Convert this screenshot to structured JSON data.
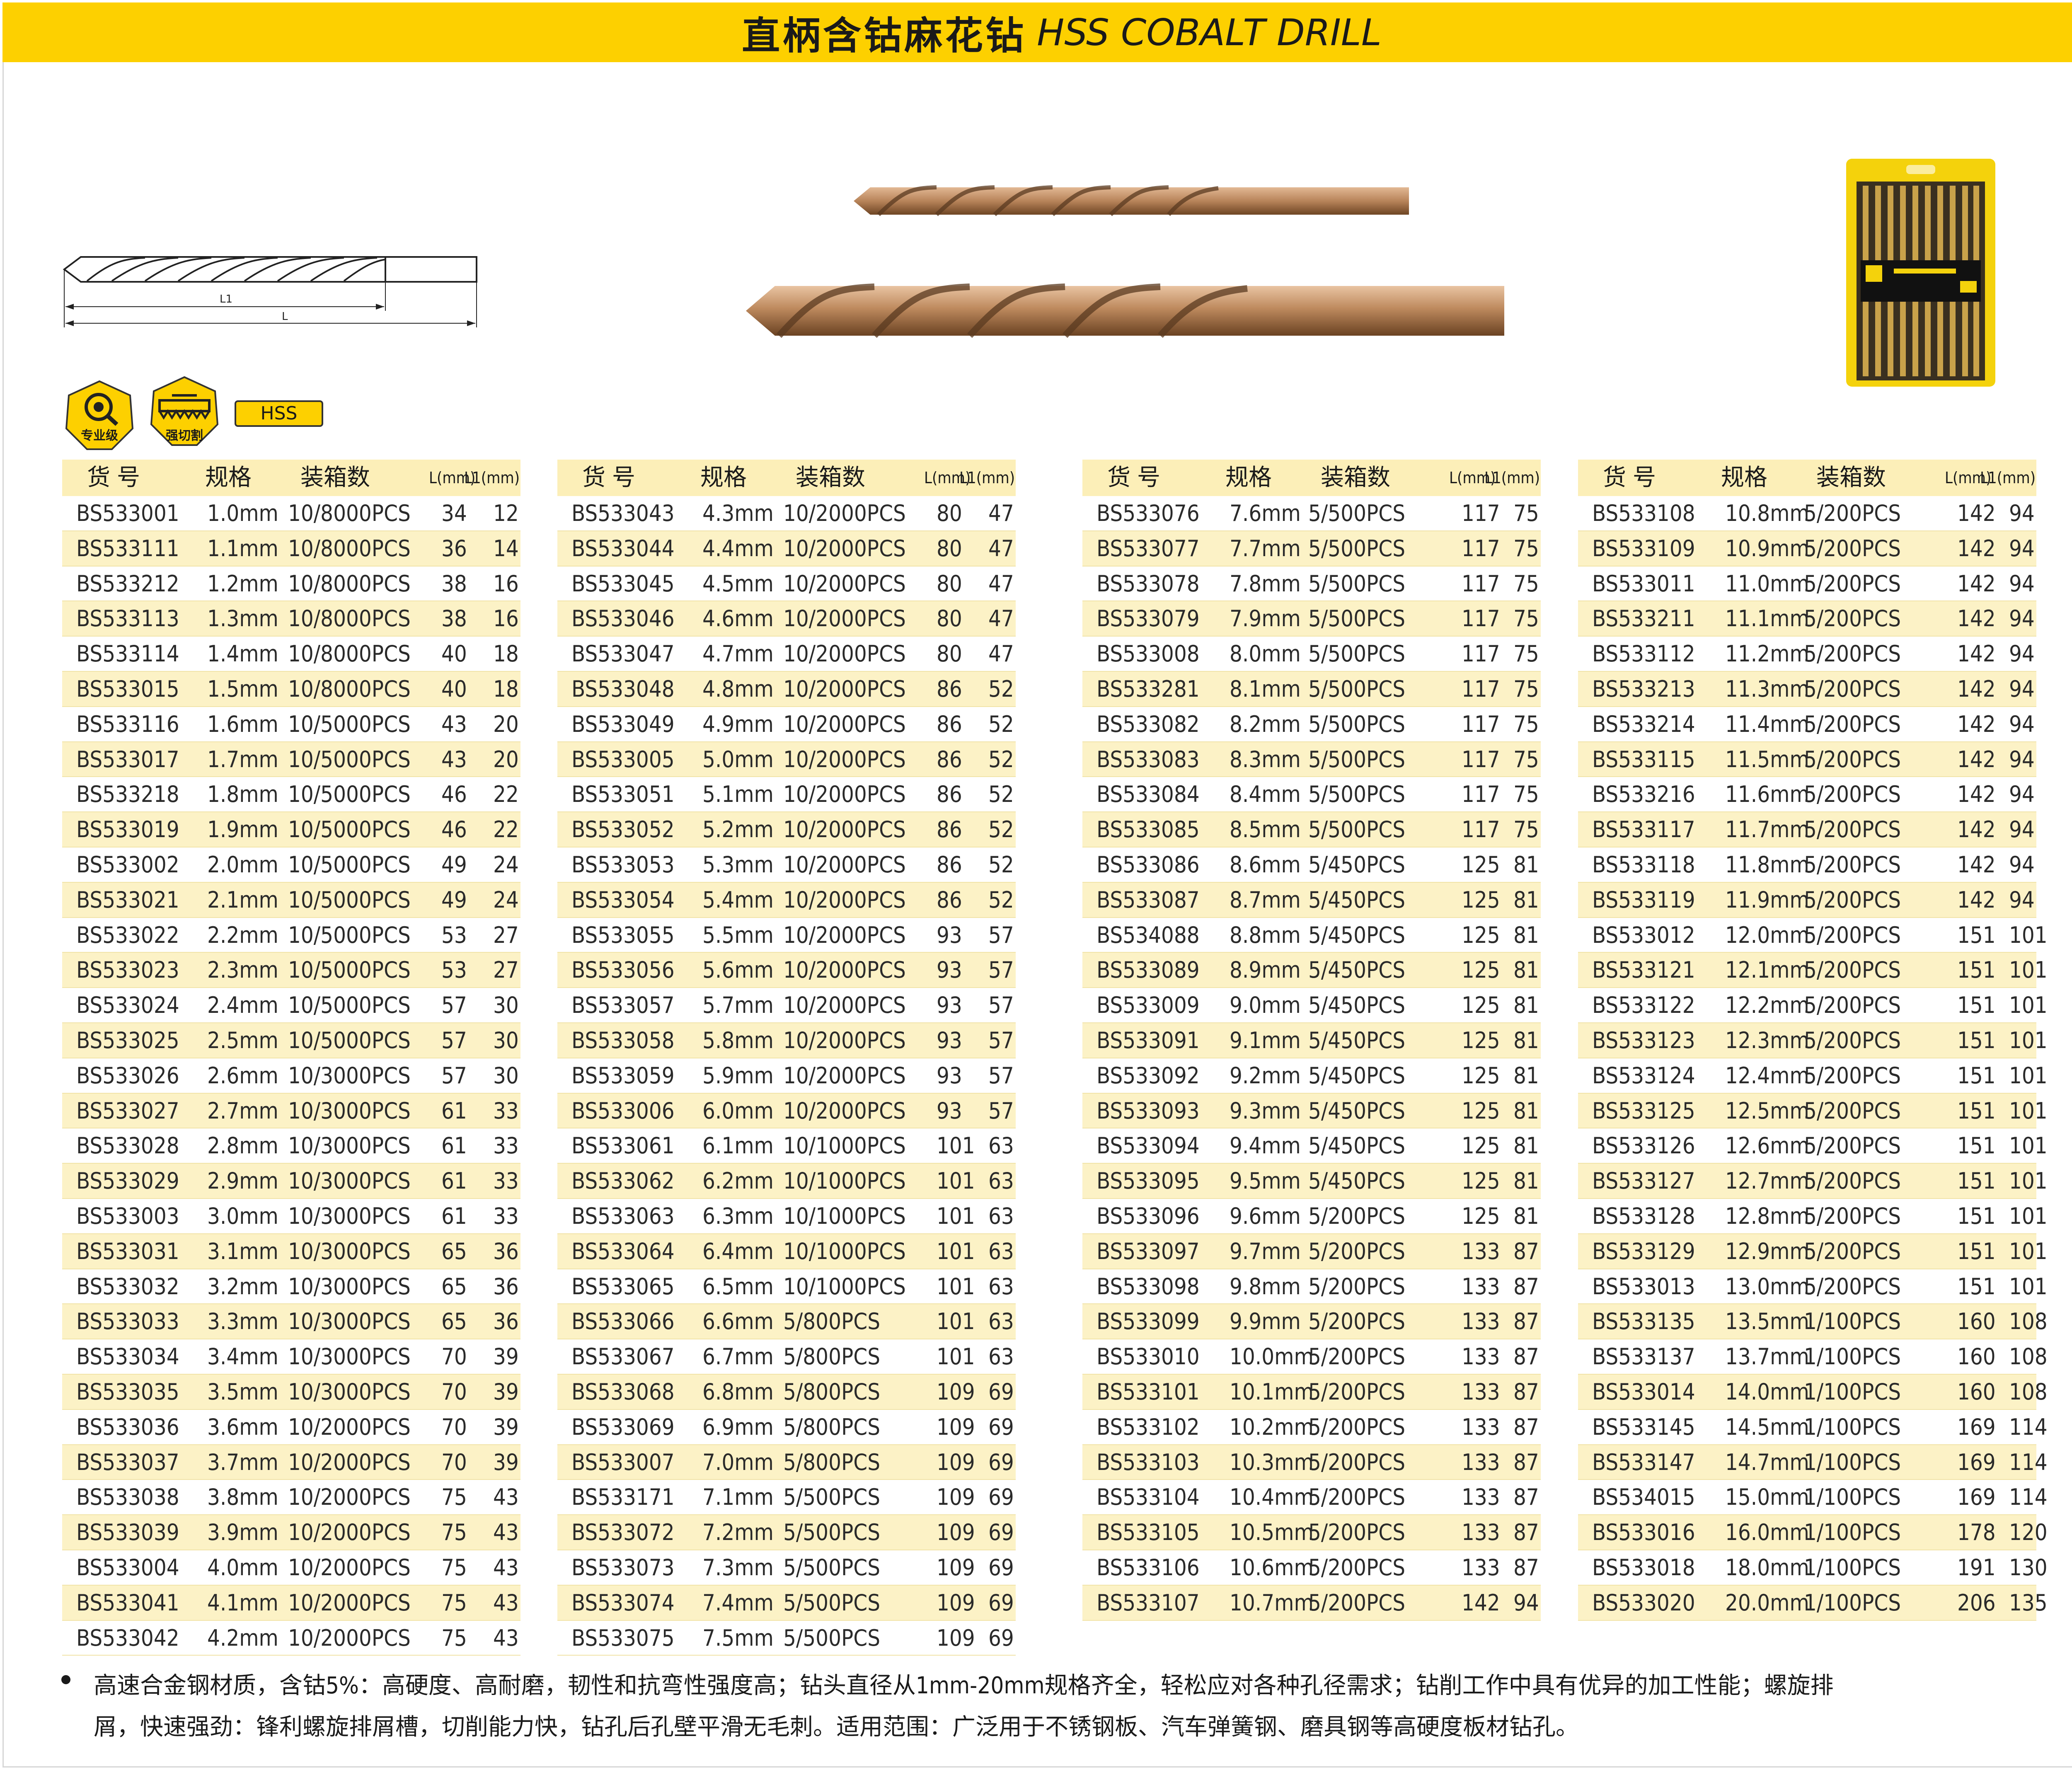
{
  "header": {
    "title_cn": "直柄含钴麻花钻",
    "title_en": "HSS COBALT DRILL"
  },
  "diagram": {
    "label_l1": "L1",
    "label_l": "L"
  },
  "badges": [
    {
      "label": "专业级",
      "icon": "magnifier-gear-icon"
    },
    {
      "label": "强切割",
      "icon": "saw-blade-icon"
    }
  ],
  "material_tag": "HSS",
  "table_headers": {
    "code": "货 号",
    "spec": "规格",
    "pack": "装箱数",
    "l": "L(mm)",
    "l1": "L1(mm)"
  },
  "tables": [
    [
      [
        "BS533001",
        "1.0mm",
        "10/8000PCS",
        "34",
        "12"
      ],
      [
        "BS533111",
        "1.1mm",
        "10/8000PCS",
        "36",
        "14"
      ],
      [
        "BS533212",
        "1.2mm",
        "10/8000PCS",
        "38",
        "16"
      ],
      [
        "BS533113",
        "1.3mm",
        "10/8000PCS",
        "38",
        "16"
      ],
      [
        "BS533114",
        "1.4mm",
        "10/8000PCS",
        "40",
        "18"
      ],
      [
        "BS533015",
        "1.5mm",
        "10/8000PCS",
        "40",
        "18"
      ],
      [
        "BS533116",
        "1.6mm",
        "10/5000PCS",
        "43",
        "20"
      ],
      [
        "BS533017",
        "1.7mm",
        "10/5000PCS",
        "43",
        "20"
      ],
      [
        "BS533218",
        "1.8mm",
        "10/5000PCS",
        "46",
        "22"
      ],
      [
        "BS533019",
        "1.9mm",
        "10/5000PCS",
        "46",
        "22"
      ],
      [
        "BS533002",
        "2.0mm",
        "10/5000PCS",
        "49",
        "24"
      ],
      [
        "BS533021",
        "2.1mm",
        "10/5000PCS",
        "49",
        "24"
      ],
      [
        "BS533022",
        "2.2mm",
        "10/5000PCS",
        "53",
        "27"
      ],
      [
        "BS533023",
        "2.3mm",
        "10/5000PCS",
        "53",
        "27"
      ],
      [
        "BS533024",
        "2.4mm",
        "10/5000PCS",
        "57",
        "30"
      ],
      [
        "BS533025",
        "2.5mm",
        "10/5000PCS",
        "57",
        "30"
      ],
      [
        "BS533026",
        "2.6mm",
        "10/3000PCS",
        "57",
        "30"
      ],
      [
        "BS533027",
        "2.7mm",
        "10/3000PCS",
        "61",
        "33"
      ],
      [
        "BS533028",
        "2.8mm",
        "10/3000PCS",
        "61",
        "33"
      ],
      [
        "BS533029",
        "2.9mm",
        "10/3000PCS",
        "61",
        "33"
      ],
      [
        "BS533003",
        "3.0mm",
        "10/3000PCS",
        "61",
        "33"
      ],
      [
        "BS533031",
        "3.1mm",
        "10/3000PCS",
        "65",
        "36"
      ],
      [
        "BS533032",
        "3.2mm",
        "10/3000PCS",
        "65",
        "36"
      ],
      [
        "BS533033",
        "3.3mm",
        "10/3000PCS",
        "65",
        "36"
      ],
      [
        "BS533034",
        "3.4mm",
        "10/3000PCS",
        "70",
        "39"
      ],
      [
        "BS533035",
        "3.5mm",
        "10/3000PCS",
        "70",
        "39"
      ],
      [
        "BS533036",
        "3.6mm",
        "10/2000PCS",
        "70",
        "39"
      ],
      [
        "BS533037",
        "3.7mm",
        "10/2000PCS",
        "70",
        "39"
      ],
      [
        "BS533038",
        "3.8mm",
        "10/2000PCS",
        "75",
        "43"
      ],
      [
        "BS533039",
        "3.9mm",
        "10/2000PCS",
        "75",
        "43"
      ],
      [
        "BS533004",
        "4.0mm",
        "10/2000PCS",
        "75",
        "43"
      ],
      [
        "BS533041",
        "4.1mm",
        "10/2000PCS",
        "75",
        "43"
      ],
      [
        "BS533042",
        "4.2mm",
        "10/2000PCS",
        "75",
        "43"
      ]
    ],
    [
      [
        "BS533043",
        "4.3mm",
        "10/2000PCS",
        "80",
        "47"
      ],
      [
        "BS533044",
        "4.4mm",
        "10/2000PCS",
        "80",
        "47"
      ],
      [
        "BS533045",
        "4.5mm",
        "10/2000PCS",
        "80",
        "47"
      ],
      [
        "BS533046",
        "4.6mm",
        "10/2000PCS",
        "80",
        "47"
      ],
      [
        "BS533047",
        "4.7mm",
        "10/2000PCS",
        "80",
        "47"
      ],
      [
        "BS533048",
        "4.8mm",
        "10/2000PCS",
        "86",
        "52"
      ],
      [
        "BS533049",
        "4.9mm",
        "10/2000PCS",
        "86",
        "52"
      ],
      [
        "BS533005",
        "5.0mm",
        "10/2000PCS",
        "86",
        "52"
      ],
      [
        "BS533051",
        "5.1mm",
        "10/2000PCS",
        "86",
        "52"
      ],
      [
        "BS533052",
        "5.2mm",
        "10/2000PCS",
        "86",
        "52"
      ],
      [
        "BS533053",
        "5.3mm",
        "10/2000PCS",
        "86",
        "52"
      ],
      [
        "BS533054",
        "5.4mm",
        "10/2000PCS",
        "86",
        "52"
      ],
      [
        "BS533055",
        "5.5mm",
        "10/2000PCS",
        "93",
        "57"
      ],
      [
        "BS533056",
        "5.6mm",
        "10/2000PCS",
        "93",
        "57"
      ],
      [
        "BS533057",
        "5.7mm",
        "10/2000PCS",
        "93",
        "57"
      ],
      [
        "BS533058",
        "5.8mm",
        "10/2000PCS",
        "93",
        "57"
      ],
      [
        "BS533059",
        "5.9mm",
        "10/2000PCS",
        "93",
        "57"
      ],
      [
        "BS533006",
        "6.0mm",
        "10/2000PCS",
        "93",
        "57"
      ],
      [
        "BS533061",
        "6.1mm",
        "10/1000PCS",
        "101",
        "63"
      ],
      [
        "BS533062",
        "6.2mm",
        "10/1000PCS",
        "101",
        "63"
      ],
      [
        "BS533063",
        "6.3mm",
        "10/1000PCS",
        "101",
        "63"
      ],
      [
        "BS533064",
        "6.4mm",
        "10/1000PCS",
        "101",
        "63"
      ],
      [
        "BS533065",
        "6.5mm",
        "10/1000PCS",
        "101",
        "63"
      ],
      [
        "BS533066",
        "6.6mm",
        "5/800PCS",
        "101",
        "63"
      ],
      [
        "BS533067",
        "6.7mm",
        "5/800PCS",
        "101",
        "63"
      ],
      [
        "BS533068",
        "6.8mm",
        "5/800PCS",
        "109",
        "69"
      ],
      [
        "BS533069",
        "6.9mm",
        "5/800PCS",
        "109",
        "69"
      ],
      [
        "BS533007",
        "7.0mm",
        "5/800PCS",
        "109",
        "69"
      ],
      [
        "BS533171",
        "7.1mm",
        "5/500PCS",
        "109",
        "69"
      ],
      [
        "BS533072",
        "7.2mm",
        "5/500PCS",
        "109",
        "69"
      ],
      [
        "BS533073",
        "7.3mm",
        "5/500PCS",
        "109",
        "69"
      ],
      [
        "BS533074",
        "7.4mm",
        "5/500PCS",
        "109",
        "69"
      ],
      [
        "BS533075",
        "7.5mm",
        "5/500PCS",
        "109",
        "69"
      ]
    ],
    [
      [
        "BS533076",
        "7.6mm",
        "5/500PCS",
        "117",
        "75"
      ],
      [
        "BS533077",
        "7.7mm",
        "5/500PCS",
        "117",
        "75"
      ],
      [
        "BS533078",
        "7.8mm",
        "5/500PCS",
        "117",
        "75"
      ],
      [
        "BS533079",
        "7.9mm",
        "5/500PCS",
        "117",
        "75"
      ],
      [
        "BS533008",
        "8.0mm",
        "5/500PCS",
        "117",
        "75"
      ],
      [
        "BS533281",
        "8.1mm",
        "5/500PCS",
        "117",
        "75"
      ],
      [
        "BS533082",
        "8.2mm",
        "5/500PCS",
        "117",
        "75"
      ],
      [
        "BS533083",
        "8.3mm",
        "5/500PCS",
        "117",
        "75"
      ],
      [
        "BS533084",
        "8.4mm",
        "5/500PCS",
        "117",
        "75"
      ],
      [
        "BS533085",
        "8.5mm",
        "5/500PCS",
        "117",
        "75"
      ],
      [
        "BS533086",
        "8.6mm",
        "5/450PCS",
        "125",
        "81"
      ],
      [
        "BS533087",
        "8.7mm",
        "5/450PCS",
        "125",
        "81"
      ],
      [
        "BS534088",
        "8.8mm",
        "5/450PCS",
        "125",
        "81"
      ],
      [
        "BS533089",
        "8.9mm",
        "5/450PCS",
        "125",
        "81"
      ],
      [
        "BS533009",
        "9.0mm",
        "5/450PCS",
        "125",
        "81"
      ],
      [
        "BS533091",
        "9.1mm",
        "5/450PCS",
        "125",
        "81"
      ],
      [
        "BS533092",
        "9.2mm",
        "5/450PCS",
        "125",
        "81"
      ],
      [
        "BS533093",
        "9.3mm",
        "5/450PCS",
        "125",
        "81"
      ],
      [
        "BS533094",
        "9.4mm",
        "5/450PCS",
        "125",
        "81"
      ],
      [
        "BS533095",
        "9.5mm",
        "5/450PCS",
        "125",
        "81"
      ],
      [
        "BS533096",
        "9.6mm",
        "5/200PCS",
        "125",
        "81"
      ],
      [
        "BS533097",
        "9.7mm",
        "5/200PCS",
        "133",
        "87"
      ],
      [
        "BS533098",
        "9.8mm",
        "5/200PCS",
        "133",
        "87"
      ],
      [
        "BS533099",
        "9.9mm",
        "5/200PCS",
        "133",
        "87"
      ],
      [
        "BS533010",
        "10.0mm",
        "5/200PCS",
        "133",
        "87"
      ],
      [
        "BS533101",
        "10.1mm",
        "5/200PCS",
        "133",
        "87"
      ],
      [
        "BS533102",
        "10.2mm",
        "5/200PCS",
        "133",
        "87"
      ],
      [
        "BS533103",
        "10.3mm",
        "5/200PCS",
        "133",
        "87"
      ],
      [
        "BS533104",
        "10.4mm",
        "5/200PCS",
        "133",
        "87"
      ],
      [
        "BS533105",
        "10.5mm",
        "5/200PCS",
        "133",
        "87"
      ],
      [
        "BS533106",
        "10.6mm",
        "5/200PCS",
        "133",
        "87"
      ],
      [
        "BS533107",
        "10.7mm",
        "5/200PCS",
        "142",
        "94"
      ]
    ],
    [
      [
        "BS533108",
        "10.8mm",
        "5/200PCS",
        "142",
        "94"
      ],
      [
        "BS533109",
        "10.9mm",
        "5/200PCS",
        "142",
        "94"
      ],
      [
        "BS533011",
        "11.0mm",
        "5/200PCS",
        "142",
        "94"
      ],
      [
        "BS533211",
        "11.1mm",
        "5/200PCS",
        "142",
        "94"
      ],
      [
        "BS533112",
        "11.2mm",
        "5/200PCS",
        "142",
        "94"
      ],
      [
        "BS533213",
        "11.3mm",
        "5/200PCS",
        "142",
        "94"
      ],
      [
        "BS533214",
        "11.4mm",
        "5/200PCS",
        "142",
        "94"
      ],
      [
        "BS533115",
        "11.5mm",
        "5/200PCS",
        "142",
        "94"
      ],
      [
        "BS533216",
        "11.6mm",
        "5/200PCS",
        "142",
        "94"
      ],
      [
        "BS533117",
        "11.7mm",
        "5/200PCS",
        "142",
        "94"
      ],
      [
        "BS533118",
        "11.8mm",
        "5/200PCS",
        "142",
        "94"
      ],
      [
        "BS533119",
        "11.9mm",
        "5/200PCS",
        "142",
        "94"
      ],
      [
        "BS533012",
        "12.0mm",
        "5/200PCS",
        "151",
        "101"
      ],
      [
        "BS533121",
        "12.1mm",
        "5/200PCS",
        "151",
        "101"
      ],
      [
        "BS533122",
        "12.2mm",
        "5/200PCS",
        "151",
        "101"
      ],
      [
        "BS533123",
        "12.3mm",
        "5/200PCS",
        "151",
        "101"
      ],
      [
        "BS533124",
        "12.4mm",
        "5/200PCS",
        "151",
        "101"
      ],
      [
        "BS533125",
        "12.5mm",
        "5/200PCS",
        "151",
        "101"
      ],
      [
        "BS533126",
        "12.6mm",
        "5/200PCS",
        "151",
        "101"
      ],
      [
        "BS533127",
        "12.7mm",
        "5/200PCS",
        "151",
        "101"
      ],
      [
        "BS533128",
        "12.8mm",
        "5/200PCS",
        "151",
        "101"
      ],
      [
        "BS533129",
        "12.9mm",
        "5/200PCS",
        "151",
        "101"
      ],
      [
        "BS533013",
        "13.0mm",
        "5/200PCS",
        "151",
        "101"
      ],
      [
        "BS533135",
        "13.5mm",
        "1/100PCS",
        "160",
        "108"
      ],
      [
        "BS533137",
        "13.7mm",
        "1/100PCS",
        "160",
        "108"
      ],
      [
        "BS533014",
        "14.0mm",
        "1/100PCS",
        "160",
        "108"
      ],
      [
        "BS533145",
        "14.5mm",
        "1/100PCS",
        "169",
        "114"
      ],
      [
        "BS533147",
        "14.7mm",
        "1/100PCS",
        "169",
        "114"
      ],
      [
        "BS534015",
        "15.0mm",
        "1/100PCS",
        "169",
        "114"
      ],
      [
        "BS533016",
        "16.0mm",
        "1/100PCS",
        "178",
        "120"
      ],
      [
        "BS533018",
        "18.0mm",
        "1/100PCS",
        "191",
        "130"
      ],
      [
        "BS533020",
        "20.0mm",
        "1/100PCS",
        "206",
        "135"
      ]
    ]
  ],
  "description": [
    "高速合金钢材质，含钴5%：高硬度、高耐磨，韧性和抗弯性强度高；钻头直径从1mm-20mm规格齐全，轻松应对各种孔径需求；钻削工作中具有优异的加工性能；螺旋排",
    "屑，快速强劲：锋利螺旋排屑槽，切削能力快，钻孔后孔壁平滑无毛刺。适用范围：广泛用于不锈钢板、汽车弹簧钢、磨具钢等高硬度板材钻孔。"
  ],
  "colors": {
    "accent": "#FDD000",
    "row_alt": "#FCF2C6",
    "header_row": "#FCEFB8",
    "copper": "#B8845A"
  }
}
